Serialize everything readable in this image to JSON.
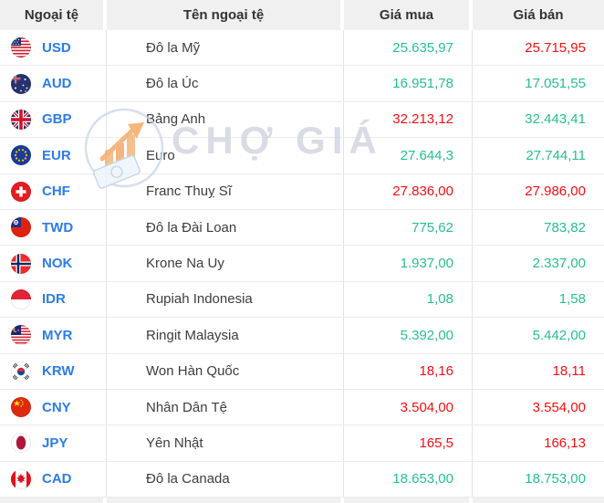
{
  "colors": {
    "up_green": "#26bf8f",
    "down_red": "#f70d12",
    "code_blue": "#2b7cea",
    "header_bg": "#f0f0f0",
    "header_text": "#333333",
    "name_text": "#3d3d3d",
    "border": "#e4e4e4"
  },
  "watermark": {
    "text": "CHỢ GIÁ",
    "logo_icon": "cho-gia-logo"
  },
  "table": {
    "columns": [
      {
        "label": "Ngoại tệ"
      },
      {
        "label": "Tên ngoại tệ"
      },
      {
        "label": "Giá mua"
      },
      {
        "label": "Giá bán"
      }
    ],
    "rows": [
      {
        "code": "USD",
        "flag": "us-flag",
        "name": "Đô la Mỹ",
        "buy": "25.635,97",
        "buy_color": "green",
        "sell": "25.715,95",
        "sell_color": "red"
      },
      {
        "code": "AUD",
        "flag": "au-flag",
        "name": "Đô la Úc",
        "buy": "16.951,78",
        "buy_color": "green",
        "sell": "17.051,55",
        "sell_color": "green"
      },
      {
        "code": "GBP",
        "flag": "gb-flag",
        "name": "Bảng Anh",
        "buy": "32.213,12",
        "buy_color": "red",
        "sell": "32.443,41",
        "sell_color": "green"
      },
      {
        "code": "EUR",
        "flag": "eu-flag",
        "name": "Euro",
        "buy": "27.644,3",
        "buy_color": "green",
        "sell": "27.744,11",
        "sell_color": "green"
      },
      {
        "code": "CHF",
        "flag": "ch-flag",
        "name": "Franc Thuỵ Sĩ",
        "buy": "27.836,00",
        "buy_color": "red",
        "sell": "27.986,00",
        "sell_color": "red"
      },
      {
        "code": "TWD",
        "flag": "tw-flag",
        "name": "Đô la Đài Loan",
        "buy": "775,62",
        "buy_color": "green",
        "sell": "783,82",
        "sell_color": "green"
      },
      {
        "code": "NOK",
        "flag": "no-flag",
        "name": "Krone Na Uy",
        "buy": "1.937,00",
        "buy_color": "green",
        "sell": "2.337,00",
        "sell_color": "green"
      },
      {
        "code": "IDR",
        "flag": "id-flag",
        "name": "Rupiah Indonesia",
        "buy": "1,08",
        "buy_color": "green",
        "sell": "1,58",
        "sell_color": "green"
      },
      {
        "code": "MYR",
        "flag": "my-flag",
        "name": "Ringit Malaysia",
        "buy": "5.392,00",
        "buy_color": "green",
        "sell": "5.442,00",
        "sell_color": "green"
      },
      {
        "code": "KRW",
        "flag": "kr-flag",
        "name": "Won Hàn Quốc",
        "buy": "18,16",
        "buy_color": "red",
        "sell": "18,11",
        "sell_color": "red"
      },
      {
        "code": "CNY",
        "flag": "cn-flag",
        "name": "Nhân Dân Tệ",
        "buy": "3.504,00",
        "buy_color": "red",
        "sell": "3.554,00",
        "sell_color": "red"
      },
      {
        "code": "JPY",
        "flag": "jp-flag",
        "name": "Yên Nhật",
        "buy": "165,5",
        "buy_color": "red",
        "sell": "166,13",
        "sell_color": "red"
      },
      {
        "code": "CAD",
        "flag": "ca-flag",
        "name": "Đô la Canada",
        "buy": "18.653,00",
        "buy_color": "green",
        "sell": "18.753,00",
        "sell_color": "green"
      }
    ]
  }
}
